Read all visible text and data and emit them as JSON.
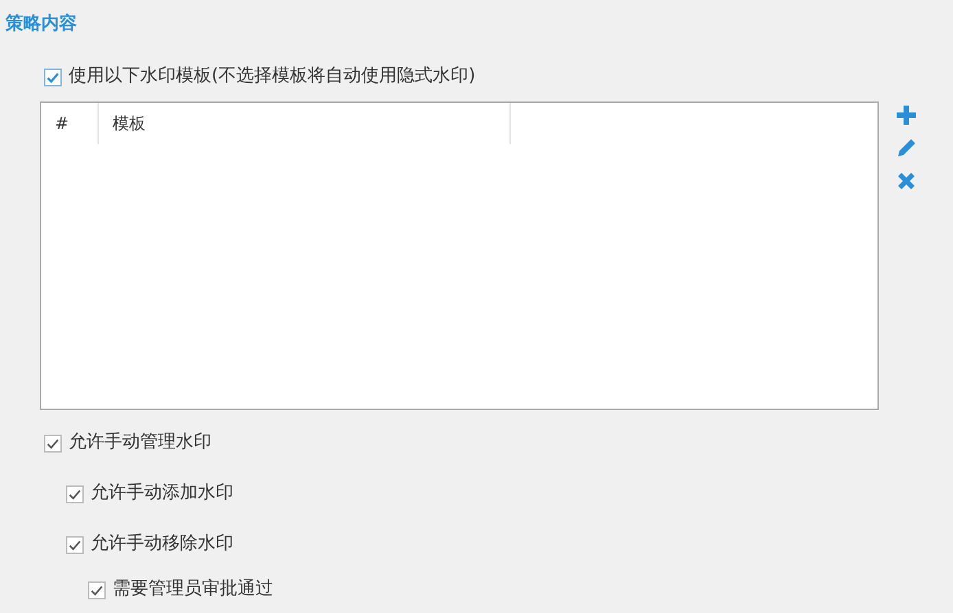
{
  "section_title": "策略内容",
  "use_templates": {
    "label": "使用以下水印模板(不选择模板将自动使用隐式水印)",
    "checked": true
  },
  "table": {
    "columns": [
      "#",
      "模板"
    ]
  },
  "options": [
    {
      "label": "允许手动管理水印",
      "checked": true,
      "children": [
        {
          "label": "允许手动添加水印",
          "checked": true
        },
        {
          "label": "允许手动移除水印",
          "checked": true,
          "children": [
            {
              "label": "需要管理员审批通过",
              "checked": true
            }
          ]
        }
      ]
    }
  ]
}
